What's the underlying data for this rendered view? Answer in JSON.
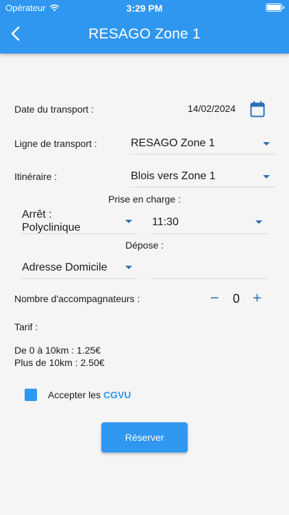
{
  "status_bar": {
    "carrier": "Opérateur",
    "time": "3:29 PM"
  },
  "appbar": {
    "title": "RESAGO Zone 1"
  },
  "form": {
    "date_label": "Date du transport :",
    "date_value": "14/02/2024",
    "ligne_label": "Ligne de transport :",
    "ligne_value": "RESAGO Zone 1",
    "itineraire_label": "Itinéraire :",
    "itineraire_value": "Blois vers Zone 1",
    "prise_label": "Prise en charge :",
    "arret_line1": "Arrêt :",
    "arret_line2": "Polyclinique",
    "heure_value": "11:30",
    "depose_label": "Dépose :",
    "depose_value": "Adresse Domicile",
    "accomp_label": "Nombre d'accompagnateurs :",
    "accomp_minus": "−",
    "accomp_count": "0",
    "accomp_plus": "+",
    "tarif_label": "Tarif :",
    "tarif_line1": "De 0 à 10km : 1.25€",
    "tarif_line2": "Plus de 10km : 2.50€",
    "accept_text": "Accepter les ",
    "accept_link": "CGVU",
    "reserve_button": "Réserver"
  },
  "colors": {
    "primary": "#2f97f0",
    "accent_dark": "#2c6fb8"
  },
  "icons": {
    "back": "chevron-left-icon",
    "calendar": "calendar-icon",
    "dropdown": "caret-down-icon"
  }
}
